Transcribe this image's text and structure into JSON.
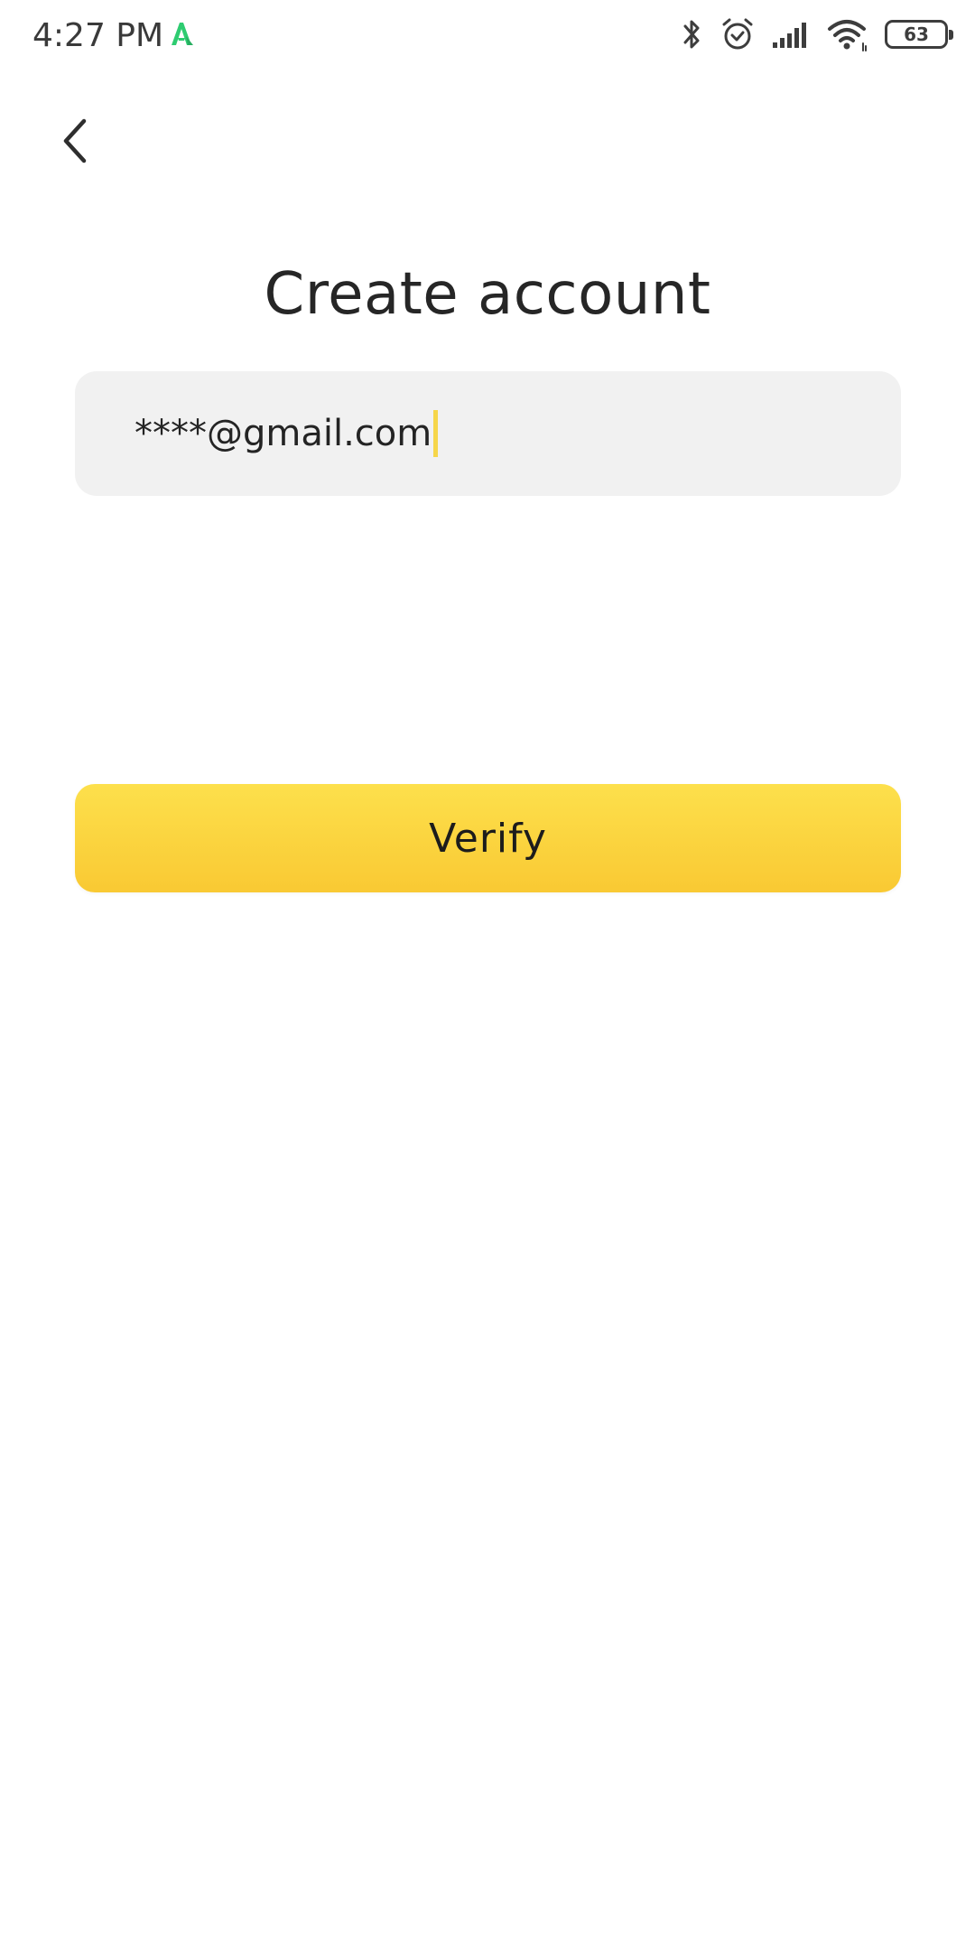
{
  "status_bar": {
    "time": "4:27 PM",
    "battery_level": "63",
    "icons": [
      "app-indicator-icon",
      "bluetooth-icon",
      "alarm-icon",
      "signal-icon",
      "wifi-icon",
      "battery-icon"
    ]
  },
  "header": {
    "back_icon": "chevron-left-icon",
    "title": "Create account"
  },
  "form": {
    "email_value": "****@gmail.com",
    "verify_label": "Verify"
  },
  "colors": {
    "accent_top": "#fde04c",
    "accent_bottom": "#f9c933",
    "field_background": "#f1f1f1",
    "caret": "#f6d64a",
    "app_indicator": "#2ecc71"
  }
}
